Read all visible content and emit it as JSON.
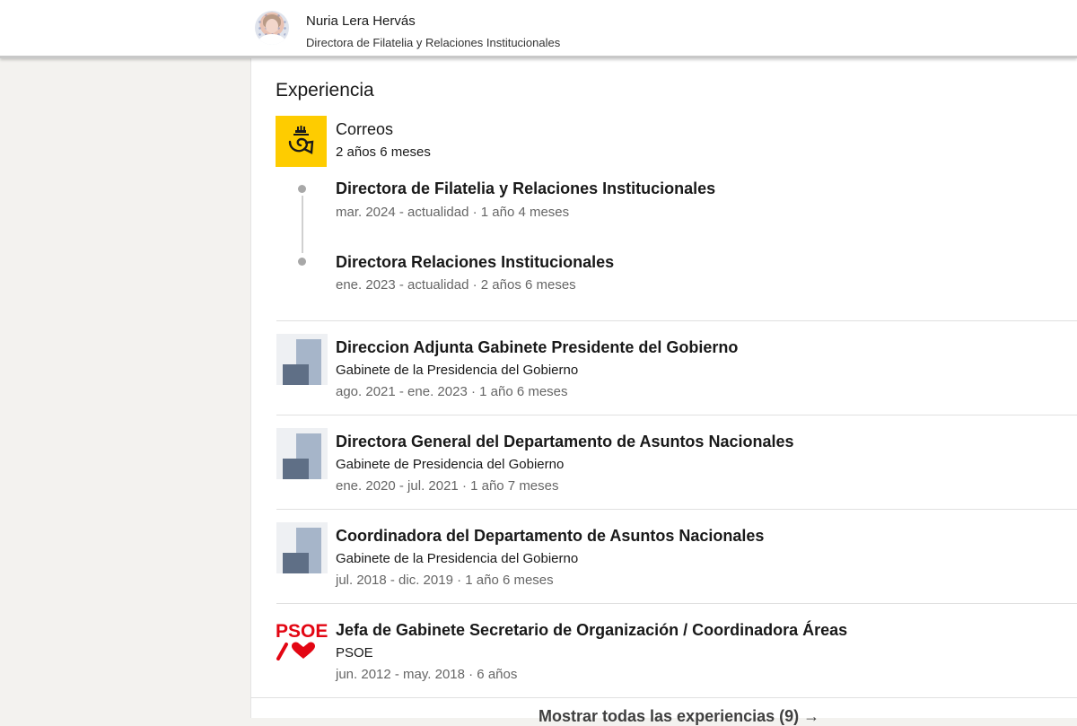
{
  "profile": {
    "name": "Nuria Lera Hervás",
    "headline": "Directora de Filatelia y Relaciones Institucionales"
  },
  "experience": {
    "title": "Experiencia",
    "grouped": {
      "company": "Correos",
      "duration": "2 años 6 meses",
      "logo_icon": "correos-horn-icon",
      "logo_color": "#fecc00",
      "roles": [
        {
          "title": "Directora de Filatelia y Relaciones Institucionales",
          "dates": "mar. 2024 - actualidad · 1 año 4 meses"
        },
        {
          "title": "Directora Relaciones Institucionales",
          "dates": "ene. 2023 - actualidad · 2 años 6 meses"
        }
      ]
    },
    "items": [
      {
        "title": "Direccion Adjunta Gabinete Presidente del Gobierno",
        "company": "Gabinete de la Presidencia del Gobierno",
        "dates": "ago. 2021 - ene. 2023 · 1 año 6 meses"
      },
      {
        "title": "Directora General del Departamento de Asuntos Nacionales",
        "company": "Gabinete de Presidencia del Gobierno",
        "dates": "ene. 2020 - jul. 2021 · 1 año 7 meses"
      },
      {
        "title": "Coordinadora del Departamento de Asuntos Nacionales",
        "company": "Gabinete de la Presidencia del Gobierno",
        "dates": "jul. 2018 - dic. 2019 · 1 año 6 meses"
      },
      {
        "title": "Jefa de Gabinete Secretario de Organización / Coordinadora Áreas",
        "company": "PSOE",
        "dates": "jun. 2012 - may. 2018 · 6 años",
        "logo_text": "PSOE",
        "logo_color": "#e30613"
      }
    ],
    "show_all": "Mostrar todas las experiencias (9) →"
  }
}
